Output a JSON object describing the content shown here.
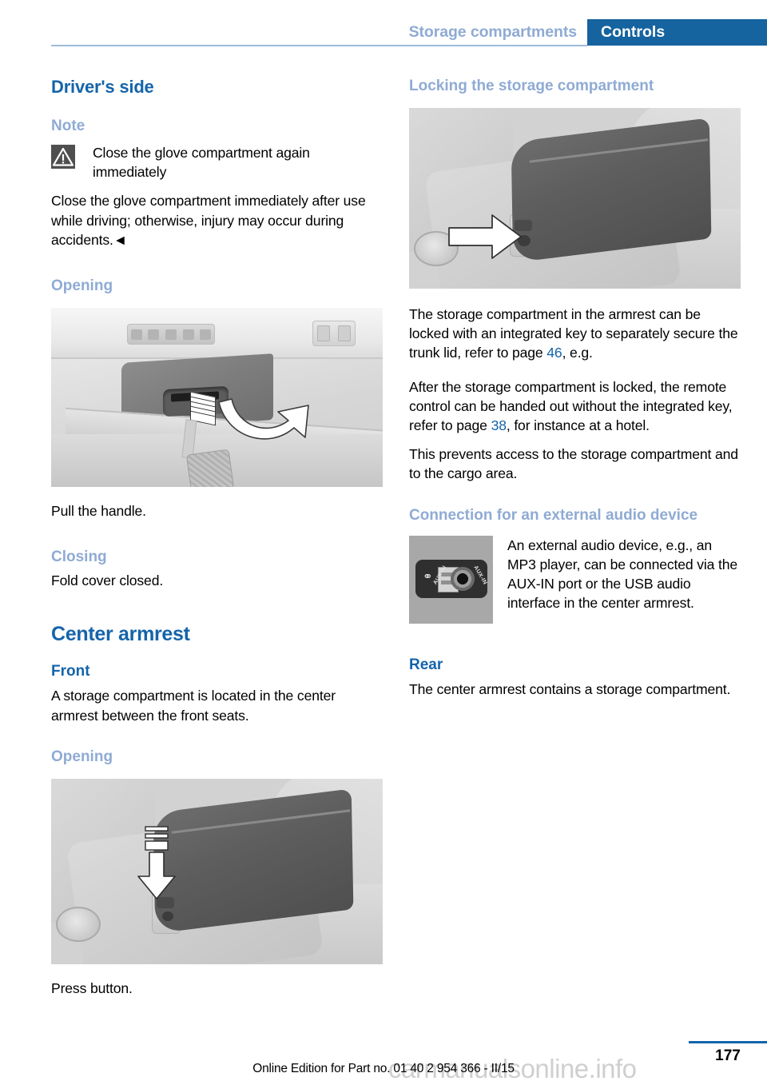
{
  "header": {
    "section_label": "Storage compartments",
    "chapter_label": "Controls",
    "accent_color": "#15639f",
    "muted_color": "#8fabd4"
  },
  "left_column": {
    "title": "Driver's side",
    "note_heading": "Note",
    "note_warning_title": "Close the glove compartment again immediately",
    "note_body": "Close the glove compartment immediately after use while driving; otherwise, injury may occur during accidents.◄",
    "opening_heading_1": "Opening",
    "figure_glovebox_caption": "Pull the handle.",
    "closing_heading": "Closing",
    "closing_body": "Fold cover closed.",
    "center_armrest_title": "Center armrest",
    "front_heading": "Front",
    "front_body": "A storage compartment is located in the center armrest between the front seats.",
    "opening_heading_2": "Opening",
    "figure_armrest_caption": "Press button."
  },
  "right_column": {
    "locking_heading": "Locking the storage compartment",
    "locking_para_1_before": "The storage compartment in the armrest can be locked with an integrated key to separately secure the trunk lid, refer to page ",
    "locking_para_1_ref": "46",
    "locking_para_1_after": ", e.g.",
    "locking_para_2_before": "After the storage compartment is locked, the remote control can be handed out without the integrated key, refer to page ",
    "locking_para_2_ref": "38",
    "locking_para_2_after": ", for instance at a hotel.",
    "locking_para_3": "This prevents access to the storage compartment and to the cargo area.",
    "audio_heading": "Connection for an external audio device",
    "audio_body": "An external audio device, e.g., an MP3 player, can be connected via the AUX-IN port or the USB audio interface in the center armrest.",
    "aux_label_left": "AUX-IN",
    "aux_label_right": "AUX-IN",
    "rear_heading": "Rear",
    "rear_body": "The center armrest contains a storage compartment."
  },
  "footer": {
    "edition_text": "Online Edition for Part no. 01 40 2 954 366 - II/15",
    "page_number": "177",
    "watermark": "carmanualsonline.info"
  }
}
